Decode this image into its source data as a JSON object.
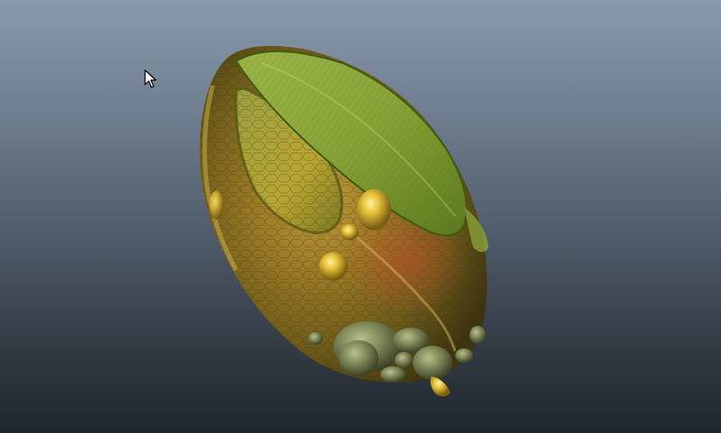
{
  "viewport": {
    "background_top": "#8a9aae",
    "background_bottom": "#20262d"
  },
  "object": {
    "icon": "organic-seed-pod-model",
    "colors": {
      "shell": "#8a7a28",
      "shell_dark": "#4a3d12",
      "leaf": "#8fae3a",
      "leaf_dark": "#4e6a1a",
      "nodules": "#6f7a52",
      "blisters": "#e2c23c"
    }
  },
  "cursor": {
    "icon": "arrow-cursor-icon"
  }
}
